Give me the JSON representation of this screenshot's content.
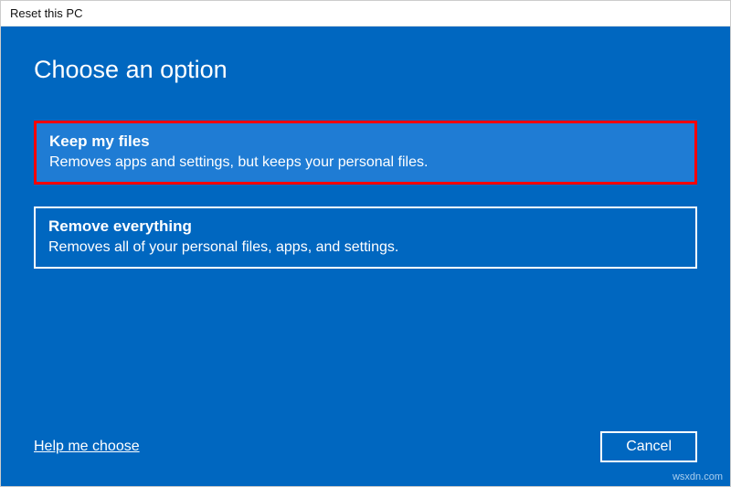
{
  "window": {
    "title": "Reset this PC"
  },
  "heading": "Choose an option",
  "options": [
    {
      "title": "Keep my files",
      "description": "Removes apps and settings, but keeps your personal files."
    },
    {
      "title": "Remove everything",
      "description": "Removes all of your personal files, apps, and settings."
    }
  ],
  "footer": {
    "help_link": "Help me choose",
    "cancel": "Cancel"
  },
  "watermark": "wsxdn.com"
}
